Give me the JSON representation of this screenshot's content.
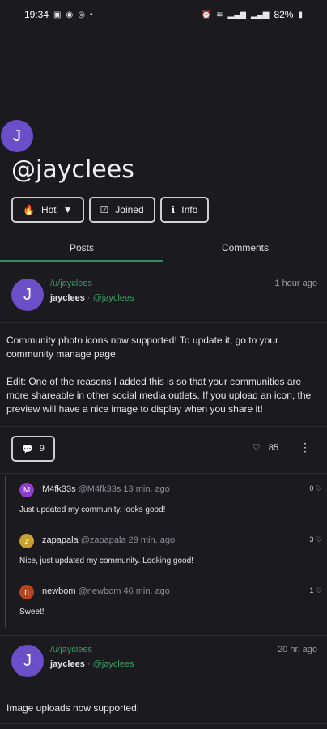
{
  "status_bar": {
    "time": "19:34",
    "left_icons": [
      "gallery-icon",
      "whatsapp-icon",
      "instagram-icon",
      "dot-icon"
    ],
    "right_icons": [
      "alarm-icon",
      "wifi-icon",
      "signal-icon",
      "signal-icon"
    ],
    "battery": "82%"
  },
  "profile": {
    "avatar_letter": "J",
    "handle": "@jayclees",
    "chips": [
      {
        "label": "Hot",
        "icon": "flame-icon"
      },
      {
        "label": "Joined",
        "icon": "checkbox-icon"
      },
      {
        "label": "Info",
        "icon": "info-icon"
      }
    ]
  },
  "tabs": [
    {
      "label": "Posts",
      "active": true
    },
    {
      "label": "Comments",
      "active": false
    }
  ],
  "post1": {
    "avatar_letter": "J",
    "community": "/u/jayclees",
    "author": "jayclees",
    "separator": "·",
    "username": "@jayclees",
    "time": "1 hour ago",
    "body_p1": "Community photo icons now supported! To update it, go to your community manage page.",
    "body_p2": "Edit: One of the reasons I added this is so that your communities are more shareable in other social media outlets. If you upload an icon, the preview will have a nice image to display when you share it!",
    "comment_count": "9",
    "likes": "85"
  },
  "comments": [
    {
      "avatar_letter": "M",
      "avatar_color": "#8e3fc9",
      "user": "M4fk33s",
      "meta": "@M4fk33s 13 min. ago",
      "score": "0",
      "text": "Just updated my community, looks good!"
    },
    {
      "avatar_letter": "z",
      "avatar_color": "#c9a12e",
      "user": "zapapala",
      "meta": "@zapapala 29 min. ago",
      "score": "3",
      "text": "Nice, just updated my community. Looking good!"
    },
    {
      "avatar_letter": "n",
      "avatar_color": "#b5451e",
      "user": "newbom",
      "meta": "@newbom 46 min. ago",
      "score": "1",
      "text": "Sweet!"
    }
  ],
  "post2": {
    "avatar_letter": "J",
    "community": "/u/jayclees",
    "author": "jayclees",
    "separator": "·",
    "username": "@jayclees",
    "time": "20 hr. ago",
    "body": "Image uploads now supported!"
  }
}
